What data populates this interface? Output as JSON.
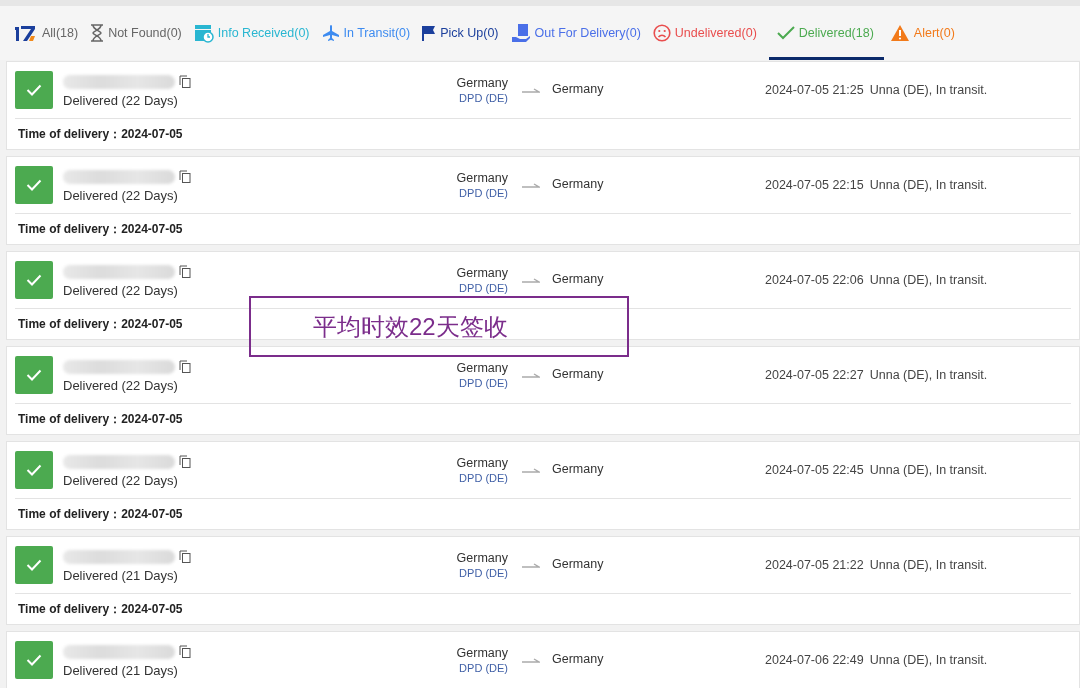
{
  "tabs": [
    {
      "kind": "all",
      "label": "All(18)",
      "color": "#666666",
      "selected": false
    },
    {
      "kind": "notfound",
      "label": "Not Found(0)",
      "color": "#666666",
      "selected": false
    },
    {
      "kind": "info",
      "label": "Info Received(0)",
      "color": "#29b6d1",
      "selected": false
    },
    {
      "kind": "transit",
      "label": "In Transit(0)",
      "color": "#3d8bf0",
      "selected": false
    },
    {
      "kind": "pickup",
      "label": "Pick Up(0)",
      "color": "#1b3f9c",
      "selected": false
    },
    {
      "kind": "outfor",
      "label": "Out For Delivery(0)",
      "color": "#4a6fe8",
      "selected": false
    },
    {
      "kind": "undelivered",
      "label": "Undelivered(0)",
      "color": "#e94d4d",
      "selected": false
    },
    {
      "kind": "delivered",
      "label": "Delivered(18)",
      "color": "#4caa50",
      "selected": true
    },
    {
      "kind": "alert",
      "label": "Alert(0)",
      "color": "#f27a1a",
      "selected": false
    }
  ],
  "shipments": [
    {
      "status": "Delivered (22 Days)",
      "origin": "Germany",
      "carrier": "DPD (DE)",
      "destination": "Germany",
      "time": "2024-07-05 21:25",
      "event": "Unna (DE), In transit.",
      "delivery_label": "Time of delivery：",
      "delivery_date": "2024-07-05"
    },
    {
      "status": "Delivered (22 Days)",
      "origin": "Germany",
      "carrier": "DPD (DE)",
      "destination": "Germany",
      "time": "2024-07-05 22:15",
      "event": "Unna (DE), In transit.",
      "delivery_label": "Time of delivery：",
      "delivery_date": "2024-07-05"
    },
    {
      "status": "Delivered (22 Days)",
      "origin": "Germany",
      "carrier": "DPD (DE)",
      "destination": "Germany",
      "time": "2024-07-05 22:06",
      "event": "Unna (DE), In transit.",
      "delivery_label": "Time of delivery：",
      "delivery_date": "2024-07-05"
    },
    {
      "status": "Delivered (22 Days)",
      "origin": "Germany",
      "carrier": "DPD (DE)",
      "destination": "Germany",
      "time": "2024-07-05 22:27",
      "event": "Unna (DE), In transit.",
      "delivery_label": "Time of delivery：",
      "delivery_date": "2024-07-05"
    },
    {
      "status": "Delivered (22 Days)",
      "origin": "Germany",
      "carrier": "DPD (DE)",
      "destination": "Germany",
      "time": "2024-07-05 22:45",
      "event": "Unna (DE), In transit.",
      "delivery_label": "Time of delivery：",
      "delivery_date": "2024-07-05"
    },
    {
      "status": "Delivered (21 Days)",
      "origin": "Germany",
      "carrier": "DPD (DE)",
      "destination": "Germany",
      "time": "2024-07-05 21:22",
      "event": "Unna (DE), In transit.",
      "delivery_label": "Time of delivery：",
      "delivery_date": "2024-07-05"
    },
    {
      "status": "Delivered (21 Days)",
      "origin": "Germany",
      "carrier": "DPD (DE)",
      "destination": "Germany",
      "time": "2024-07-06 22:49",
      "event": "Unna (DE), In transit."
    }
  ],
  "annotation": {
    "text": "平均时效22天签收"
  }
}
